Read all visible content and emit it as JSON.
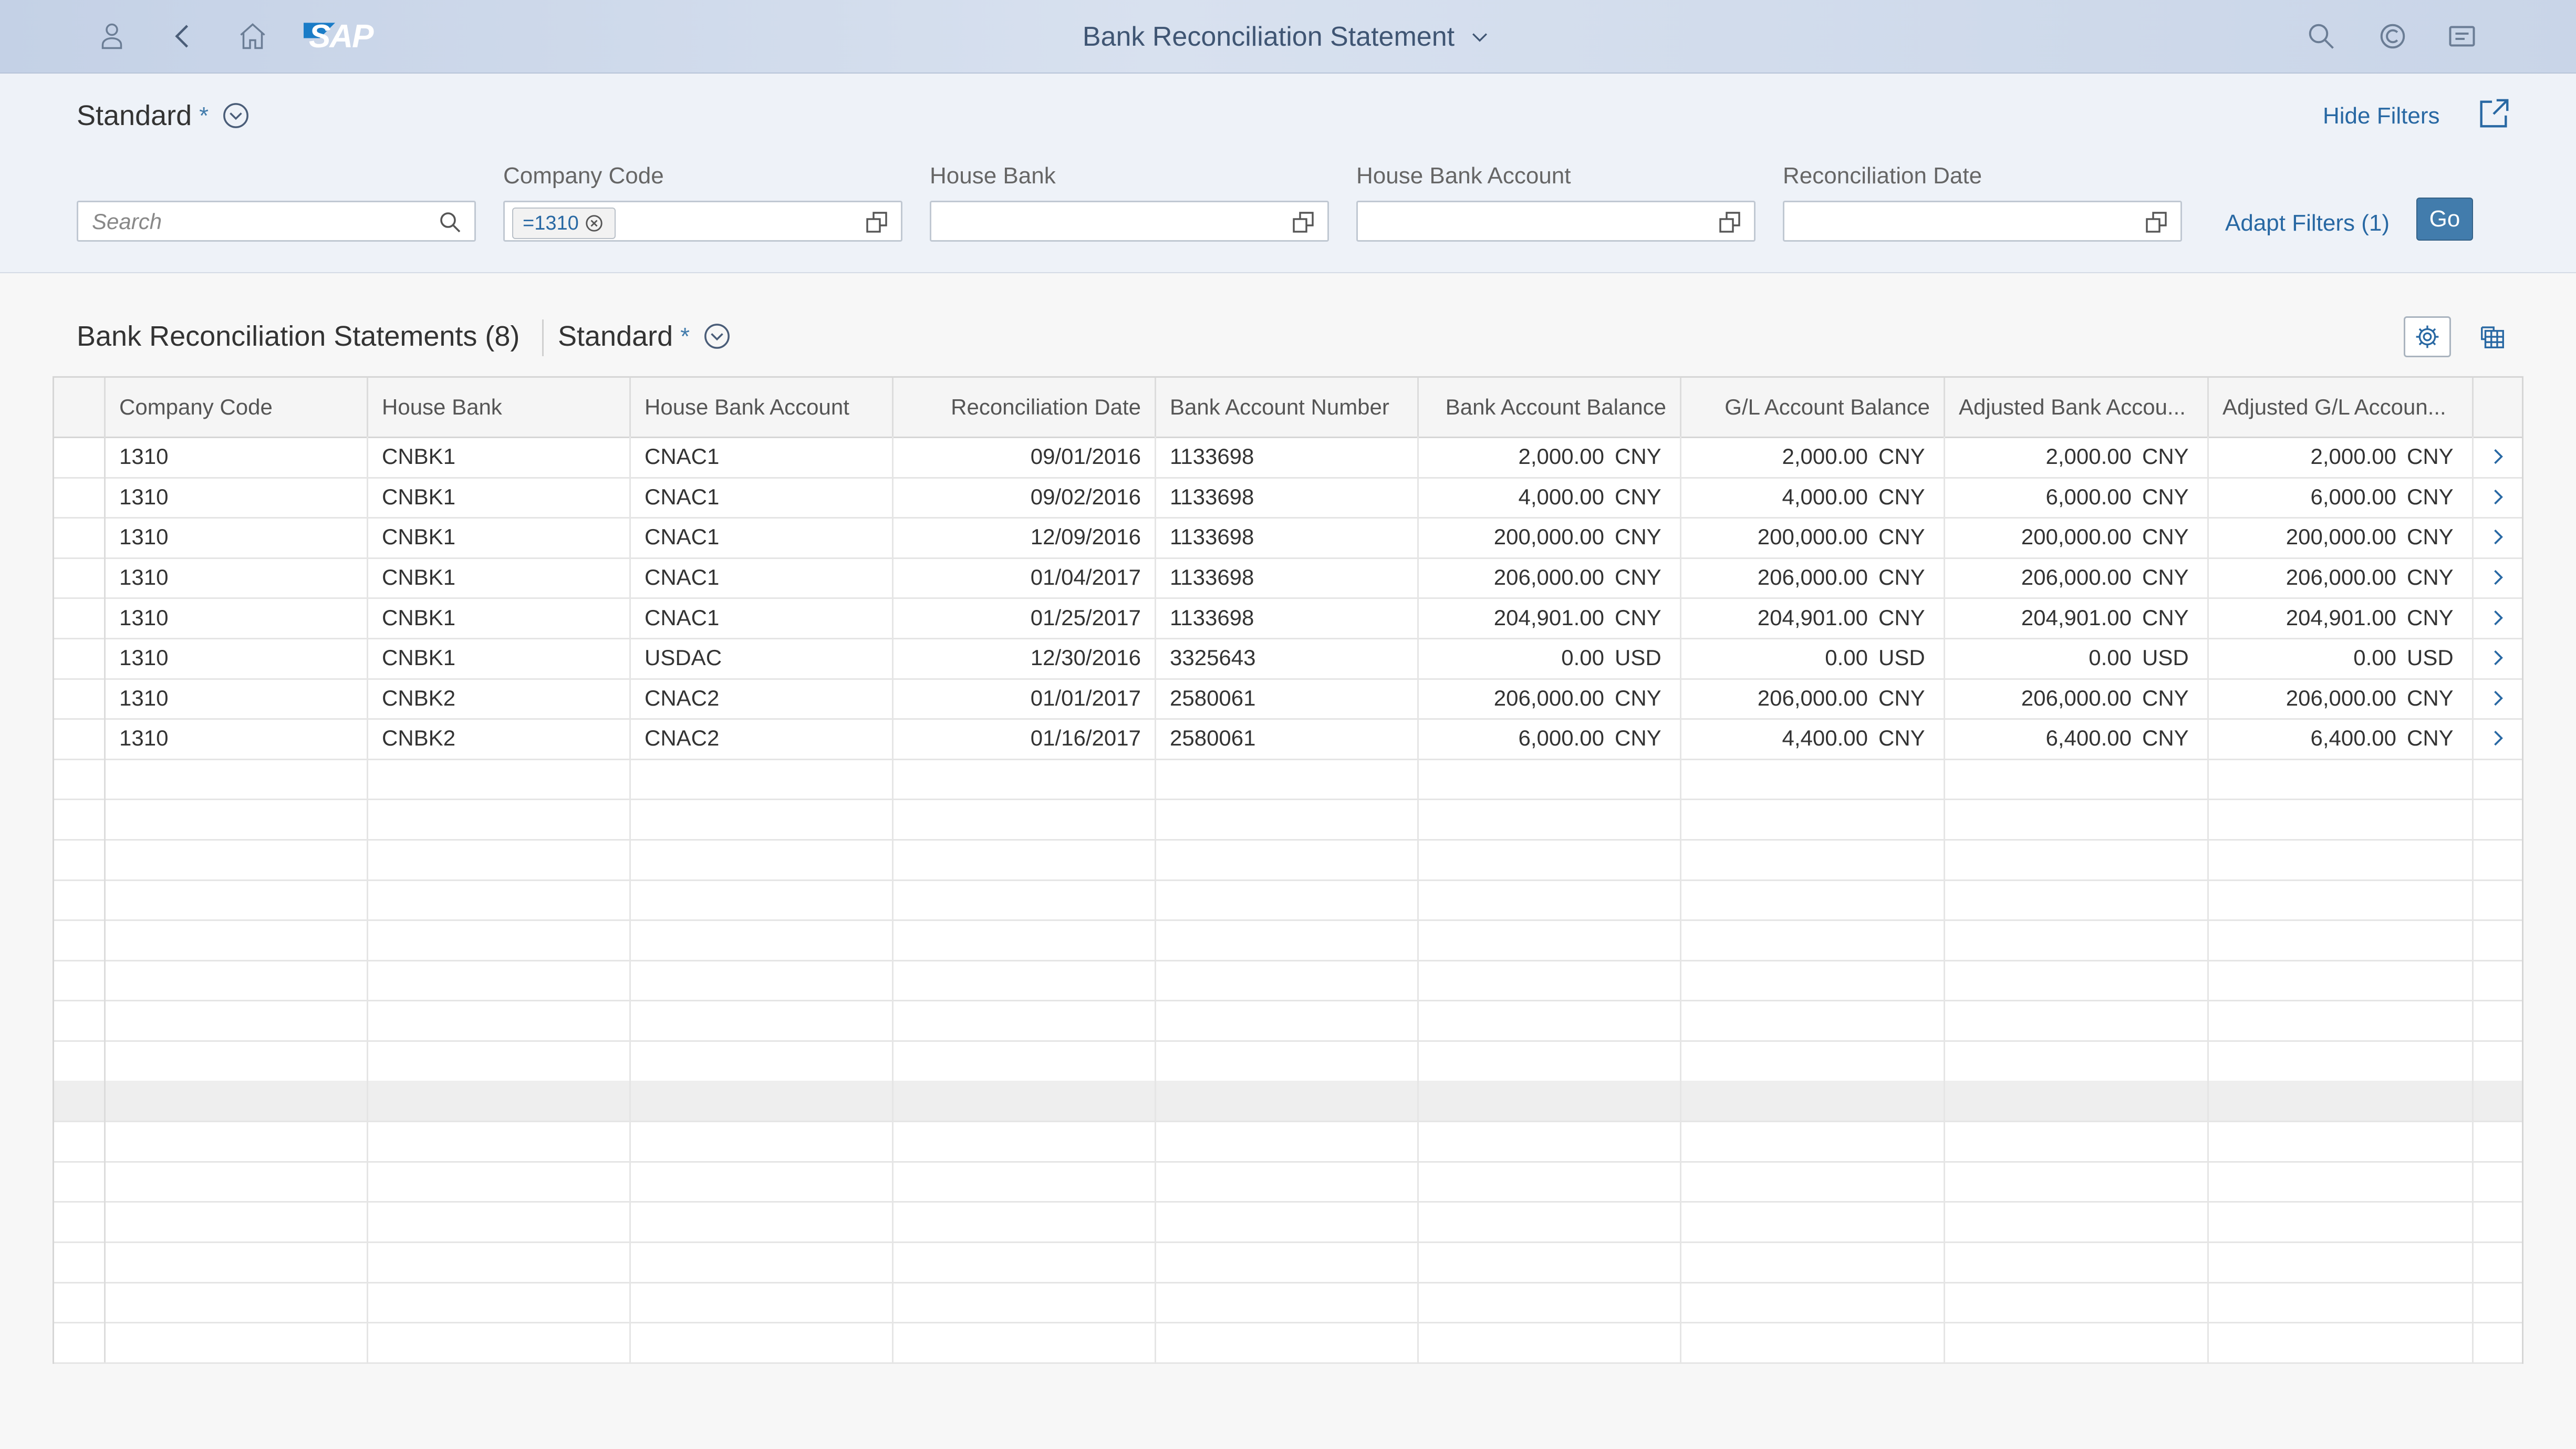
{
  "shell": {
    "title": "Bank Reconciliation Statement",
    "logo_text": "SAP",
    "brand_color": "#1a7cc7",
    "icons": [
      "user-icon",
      "back-icon",
      "home-icon",
      "search-icon",
      "copilot-icon",
      "notifications-icon"
    ]
  },
  "filter_bar": {
    "variant_name": "Standard",
    "variant_modified": "*",
    "hide_filters_label": "Hide Filters",
    "search_placeholder": "Search",
    "fields": [
      {
        "label": "Company Code",
        "token": "=1310"
      },
      {
        "label": "House Bank"
      },
      {
        "label": "House Bank Account"
      },
      {
        "label": "Reconciliation Date"
      }
    ],
    "adapt_filters_label": "Adapt Filters (1)",
    "go_label": "Go"
  },
  "table": {
    "title": "Bank Reconciliation Statements (8)",
    "variant_name": "Standard",
    "variant_modified": "*",
    "columns": [
      "Company Code",
      "House Bank",
      "House Bank Account",
      "Reconciliation Date",
      "Bank Account Number",
      "Bank Account Balance",
      "G/L Account Balance",
      "Adjusted Bank Accou...",
      "Adjusted G/L Accoun..."
    ],
    "rows": [
      {
        "company_code": "1310",
        "house_bank": "CNBK1",
        "house_bank_account": "CNAC1",
        "reconciliation_date": "09/01/2016",
        "bank_account_number": "1133698",
        "bank_account_balance": "2,000.00",
        "gl_account_balance": "2,000.00",
        "adjusted_bank_balance": "2,000.00",
        "adjusted_gl_balance": "2,000.00",
        "currency": "CNY"
      },
      {
        "company_code": "1310",
        "house_bank": "CNBK1",
        "house_bank_account": "CNAC1",
        "reconciliation_date": "09/02/2016",
        "bank_account_number": "1133698",
        "bank_account_balance": "4,000.00",
        "gl_account_balance": "4,000.00",
        "adjusted_bank_balance": "6,000.00",
        "adjusted_gl_balance": "6,000.00",
        "currency": "CNY"
      },
      {
        "company_code": "1310",
        "house_bank": "CNBK1",
        "house_bank_account": "CNAC1",
        "reconciliation_date": "12/09/2016",
        "bank_account_number": "1133698",
        "bank_account_balance": "200,000.00",
        "gl_account_balance": "200,000.00",
        "adjusted_bank_balance": "200,000.00",
        "adjusted_gl_balance": "200,000.00",
        "currency": "CNY"
      },
      {
        "company_code": "1310",
        "house_bank": "CNBK1",
        "house_bank_account": "CNAC1",
        "reconciliation_date": "01/04/2017",
        "bank_account_number": "1133698",
        "bank_account_balance": "206,000.00",
        "gl_account_balance": "206,000.00",
        "adjusted_bank_balance": "206,000.00",
        "adjusted_gl_balance": "206,000.00",
        "currency": "CNY"
      },
      {
        "company_code": "1310",
        "house_bank": "CNBK1",
        "house_bank_account": "CNAC1",
        "reconciliation_date": "01/25/2017",
        "bank_account_number": "1133698",
        "bank_account_balance": "204,901.00",
        "gl_account_balance": "204,901.00",
        "adjusted_bank_balance": "204,901.00",
        "adjusted_gl_balance": "204,901.00",
        "currency": "CNY"
      },
      {
        "company_code": "1310",
        "house_bank": "CNBK1",
        "house_bank_account": "USDAC",
        "reconciliation_date": "12/30/2016",
        "bank_account_number": "3325643",
        "bank_account_balance": "0.00",
        "gl_account_balance": "0.00",
        "adjusted_bank_balance": "0.00",
        "adjusted_gl_balance": "0.00",
        "currency": "USD"
      },
      {
        "company_code": "1310",
        "house_bank": "CNBK2",
        "house_bank_account": "CNAC2",
        "reconciliation_date": "01/01/2017",
        "bank_account_number": "2580061",
        "bank_account_balance": "206,000.00",
        "gl_account_balance": "206,000.00",
        "adjusted_bank_balance": "206,000.00",
        "adjusted_gl_balance": "206,000.00",
        "currency": "CNY"
      },
      {
        "company_code": "1310",
        "house_bank": "CNBK2",
        "house_bank_account": "CNAC2",
        "reconciliation_date": "01/16/2017",
        "bank_account_number": "2580061",
        "bank_account_balance": "6,000.00",
        "gl_account_balance": "4,400.00",
        "adjusted_bank_balance": "6,400.00",
        "adjusted_gl_balance": "6,400.00",
        "currency": "CNY"
      }
    ],
    "empty_rows": 15,
    "highlighted_empty_row": 8
  }
}
